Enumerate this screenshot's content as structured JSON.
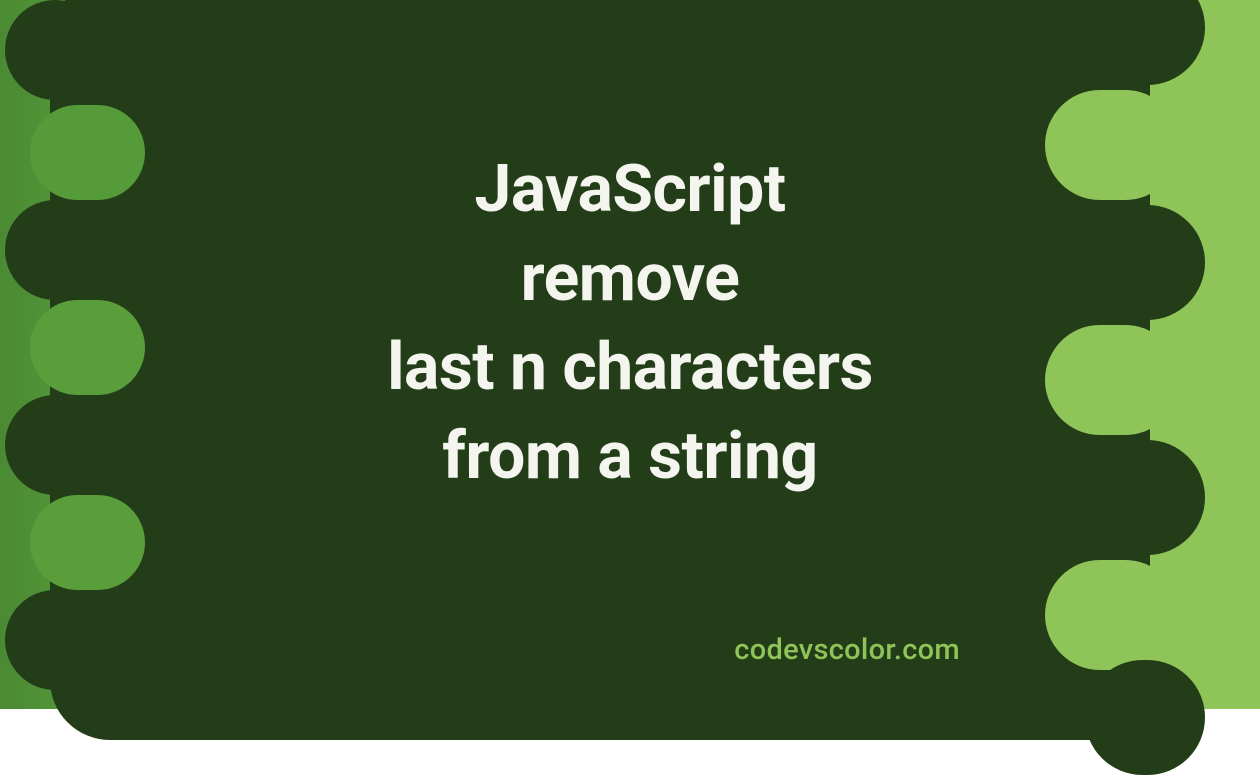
{
  "title": {
    "line1": "JavaScript",
    "line2": "remove",
    "line3": "last n characters",
    "line4": "from a string"
  },
  "watermark": "codevscolor.com",
  "colors": {
    "darkGreen": "#243d19",
    "midGreen": "#5fa43e",
    "lightGreen": "#8fc459",
    "leftGreen": "#4a8a33",
    "textWhite": "#f5f5f0"
  }
}
